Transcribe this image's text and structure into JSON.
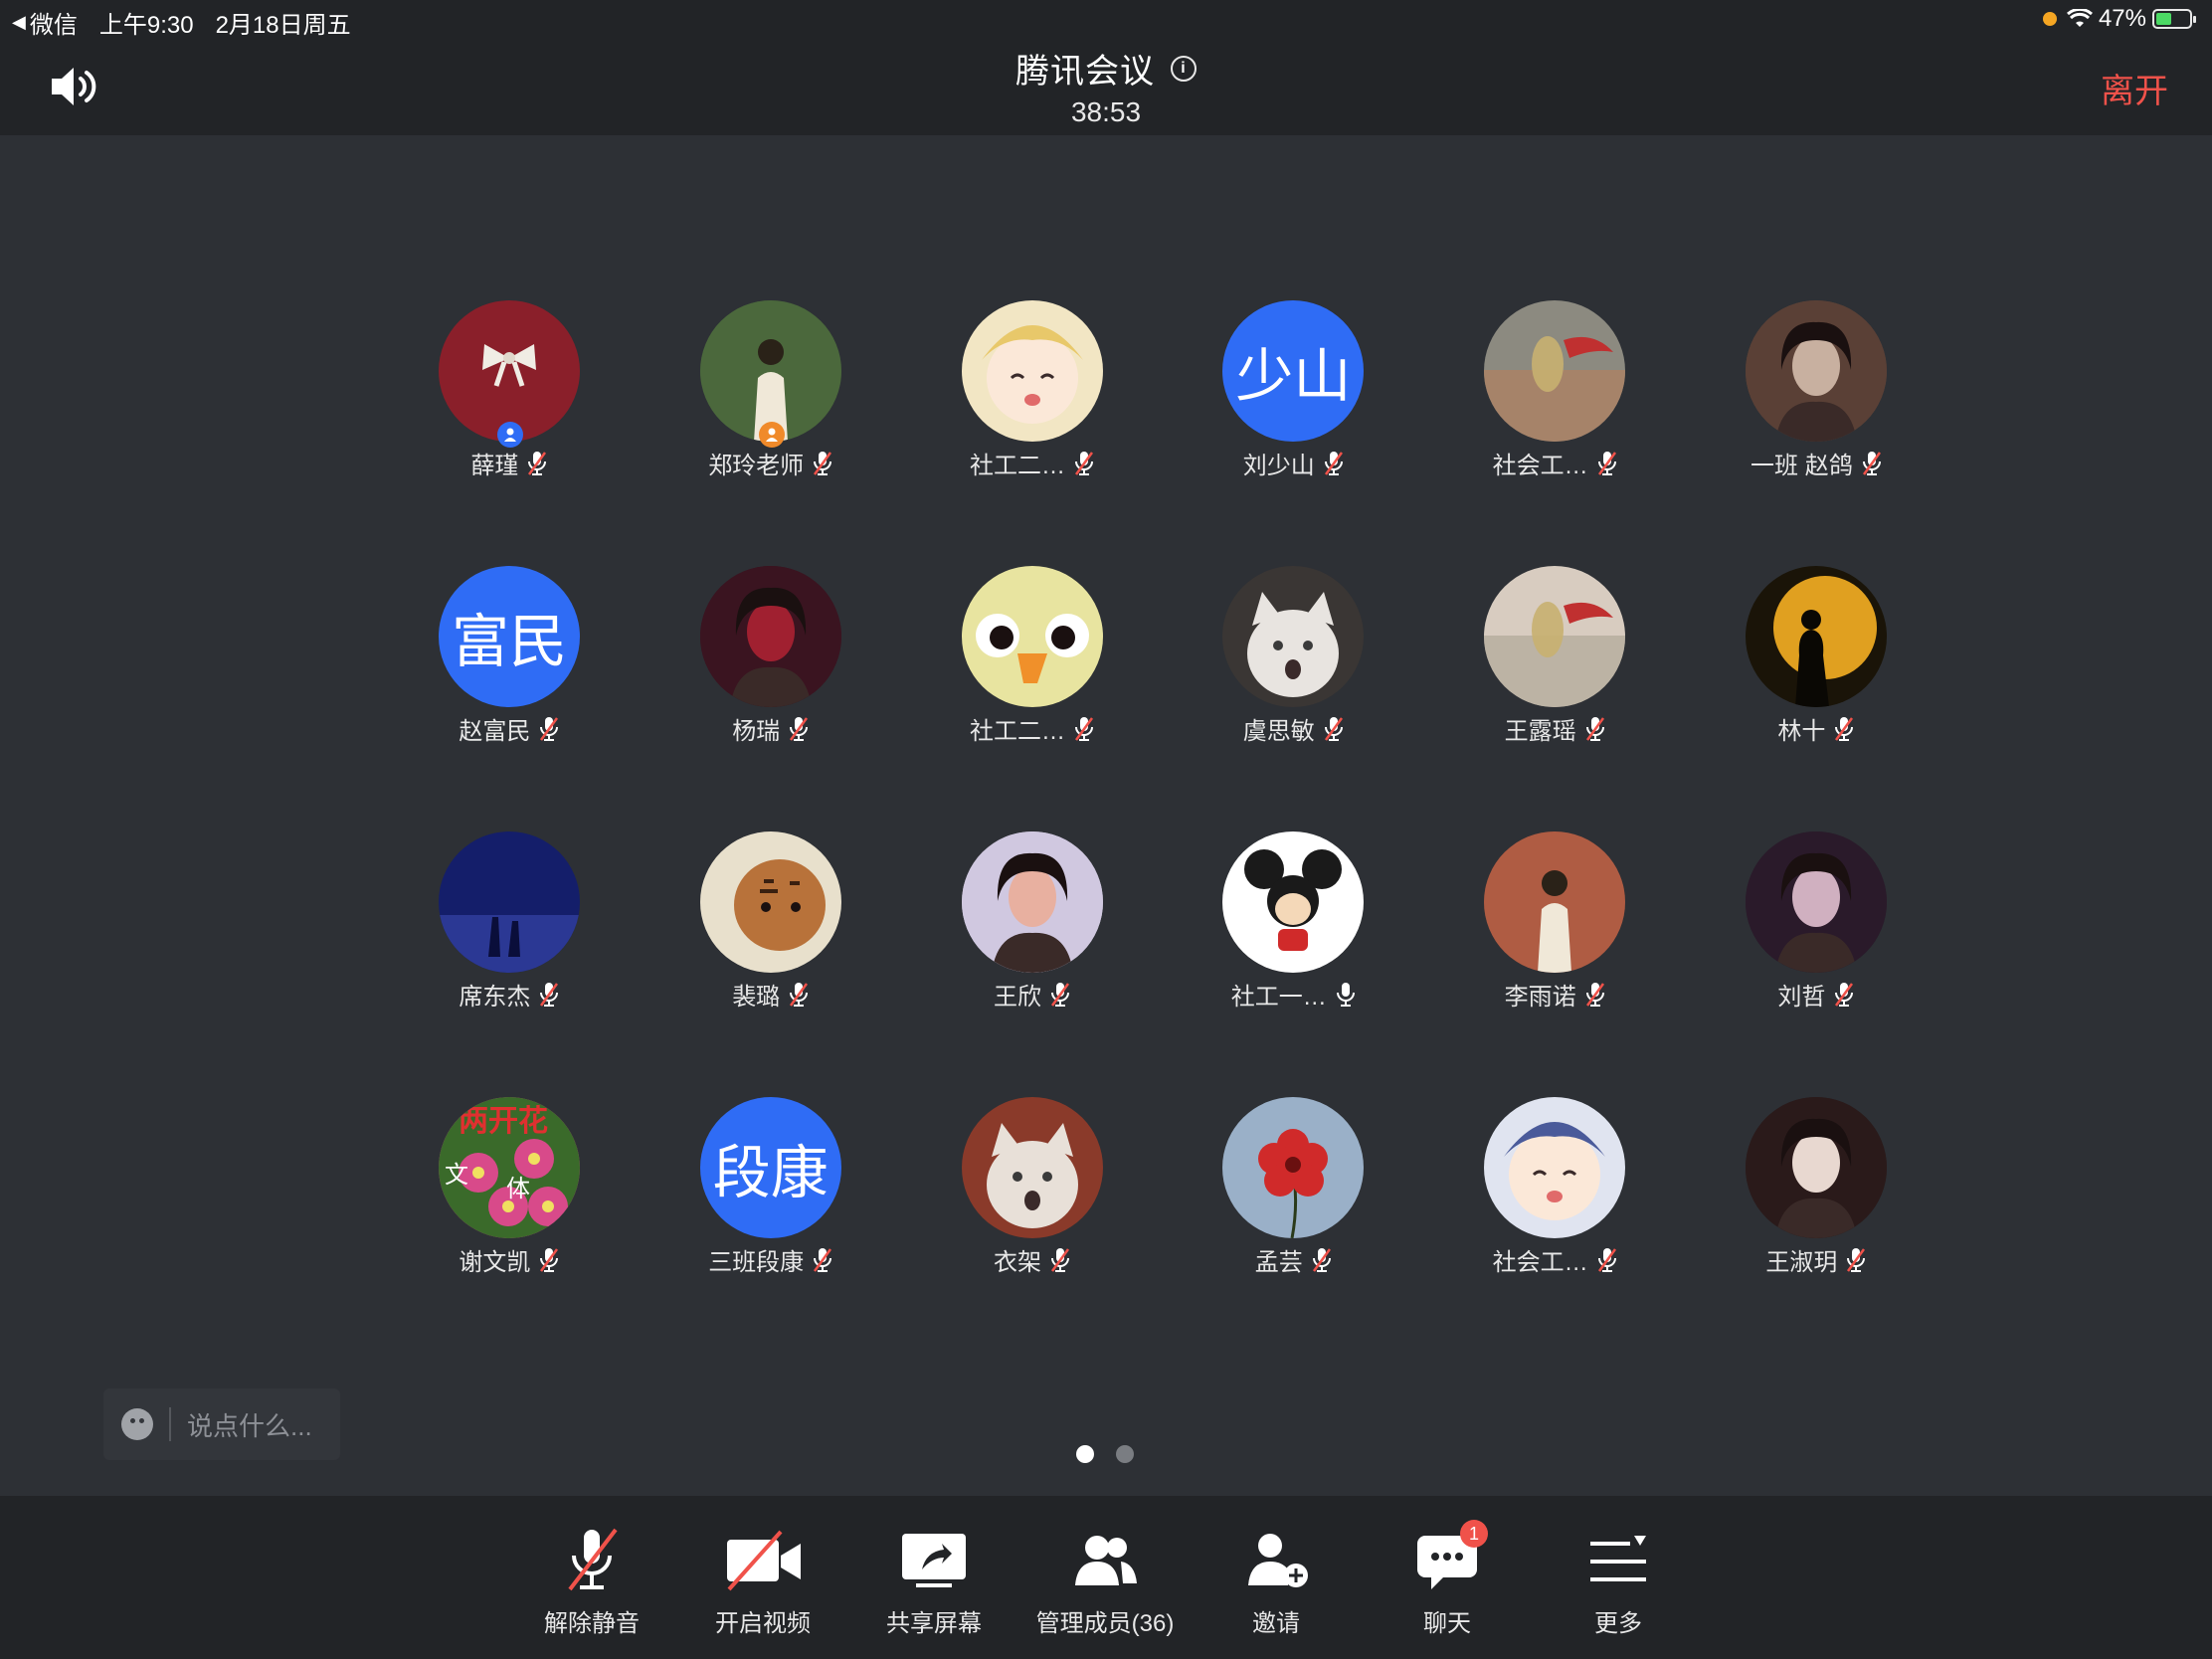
{
  "status_bar": {
    "back_app": "微信",
    "time": "上午9:30",
    "date": "2月18日周五",
    "battery_text": "47%",
    "battery_level": 0.47,
    "colors": {
      "recording_dot": "#f5a623",
      "battery_fill": "#4cd964"
    }
  },
  "header": {
    "title": "腾讯会议",
    "duration": "38:53",
    "leave_label": "离开",
    "info_symbol": "i",
    "leave_color": "#f0524a"
  },
  "participants": [
    {
      "name": "薛瑾",
      "avatar": {
        "kind": "image",
        "colors": [
          "#8a1f2a",
          "#a4242f"
        ],
        "motif": "bow"
      },
      "muted": true,
      "badge": "blue"
    },
    {
      "name": "郑玲老师",
      "avatar": {
        "kind": "image",
        "colors": [
          "#3e5a34",
          "#5a7a48"
        ],
        "motif": "person"
      },
      "muted": true,
      "badge": "orange"
    },
    {
      "name": "社工二…",
      "avatar": {
        "kind": "image",
        "colors": [
          "#f2e6c4",
          "#e8c86a"
        ],
        "motif": "anime"
      },
      "muted": true
    },
    {
      "name": "刘少山",
      "avatar": {
        "kind": "text",
        "text": "少山"
      },
      "muted": true
    },
    {
      "name": "社会工…",
      "avatar": {
        "kind": "image",
        "colors": [
          "#8c8a80",
          "#b08060"
        ],
        "motif": "painting"
      },
      "muted": true
    },
    {
      "name": "一班 赵鸽",
      "avatar": {
        "kind": "image",
        "colors": [
          "#5a4036",
          "#c8b0a0"
        ],
        "motif": "portrait"
      },
      "muted": true
    },
    {
      "name": "赵富民",
      "avatar": {
        "kind": "text",
        "text": "富民"
      },
      "muted": true
    },
    {
      "name": "杨瑞",
      "avatar": {
        "kind": "image",
        "colors": [
          "#3a1420",
          "#a02030"
        ],
        "motif": "portrait"
      },
      "muted": true
    },
    {
      "name": "社工二…",
      "avatar": {
        "kind": "image",
        "colors": [
          "#e8e4a0",
          "#f0902a"
        ],
        "motif": "duck"
      },
      "muted": true
    },
    {
      "name": "虞思敏",
      "avatar": {
        "kind": "image",
        "colors": [
          "#3a3634",
          "#e8e4e0"
        ],
        "motif": "cat"
      },
      "muted": true
    },
    {
      "name": "王露瑶",
      "avatar": {
        "kind": "image",
        "colors": [
          "#d8ccc0",
          "#b0a898"
        ],
        "motif": "painting"
      },
      "muted": true
    },
    {
      "name": "林十",
      "avatar": {
        "kind": "image",
        "colors": [
          "#1a1408",
          "#e0a020"
        ],
        "motif": "moon"
      },
      "muted": true
    },
    {
      "name": "席东杰",
      "avatar": {
        "kind": "image",
        "colors": [
          "#141e6a",
          "#3a4ab0"
        ],
        "motif": "night"
      },
      "muted": true
    },
    {
      "name": "裴璐",
      "avatar": {
        "kind": "image",
        "colors": [
          "#e8e0cc",
          "#b8723a"
        ],
        "motif": "tiger"
      },
      "muted": true
    },
    {
      "name": "王欣",
      "avatar": {
        "kind": "image",
        "colors": [
          "#d0c8e0",
          "#e8b0a0"
        ],
        "motif": "portrait"
      },
      "muted": true
    },
    {
      "name": "社工一…",
      "avatar": {
        "kind": "image",
        "colors": [
          "#ffffff",
          "#d02a2a"
        ],
        "motif": "mouse"
      },
      "muted": false
    },
    {
      "name": "李雨诺",
      "avatar": {
        "kind": "image",
        "colors": [
          "#a0503a",
          "#c06a50"
        ],
        "motif": "person"
      },
      "muted": true
    },
    {
      "name": "刘哲",
      "avatar": {
        "kind": "image",
        "colors": [
          "#2a1a2a",
          "#d0b0c0"
        ],
        "motif": "portrait"
      },
      "muted": true
    },
    {
      "name": "谢文凯",
      "avatar": {
        "kind": "image",
        "colors": [
          "#d84a8a",
          "#3a6a2a"
        ],
        "motif": "flowers",
        "text": [
          "两开花",
          "文",
          "体"
        ]
      },
      "muted": true
    },
    {
      "name": "三班段康",
      "avatar": {
        "kind": "text",
        "text": "段康"
      },
      "muted": true
    },
    {
      "name": "衣架",
      "avatar": {
        "kind": "image",
        "colors": [
          "#8a3a2a",
          "#e8e0d8"
        ],
        "motif": "cat"
      },
      "muted": true
    },
    {
      "name": "孟芸",
      "avatar": {
        "kind": "image",
        "colors": [
          "#9ab0c8",
          "#d02a2a"
        ],
        "motif": "flower"
      },
      "muted": true
    },
    {
      "name": "社会工…",
      "avatar": {
        "kind": "image",
        "colors": [
          "#e0e4f0",
          "#4a5a9a"
        ],
        "motif": "anime"
      },
      "muted": true
    },
    {
      "name": "王淑玥",
      "avatar": {
        "kind": "image",
        "colors": [
          "#2a1a1a",
          "#e8d8d0"
        ],
        "motif": "portrait"
      },
      "muted": true
    }
  ],
  "chat": {
    "placeholder": "说点什么..."
  },
  "pagination": {
    "pages": 2,
    "current": 1
  },
  "toolbar": {
    "items": [
      {
        "label": "解除静音",
        "icon": "mic-muted-icon"
      },
      {
        "label": "开启视频",
        "icon": "video-off-icon"
      },
      {
        "label": "共享屏幕",
        "icon": "share-screen-icon"
      },
      {
        "label": "管理成员(36)",
        "icon": "members-icon"
      },
      {
        "label": "邀请",
        "icon": "invite-icon"
      },
      {
        "label": "聊天",
        "icon": "chat-icon",
        "badge": "1"
      },
      {
        "label": "更多",
        "icon": "more-icon"
      }
    ]
  },
  "colors": {
    "accent_blue": "#2f6cf5",
    "muted_red": "#f0524a",
    "background": "#2d3035",
    "bar_background": "#222427"
  }
}
